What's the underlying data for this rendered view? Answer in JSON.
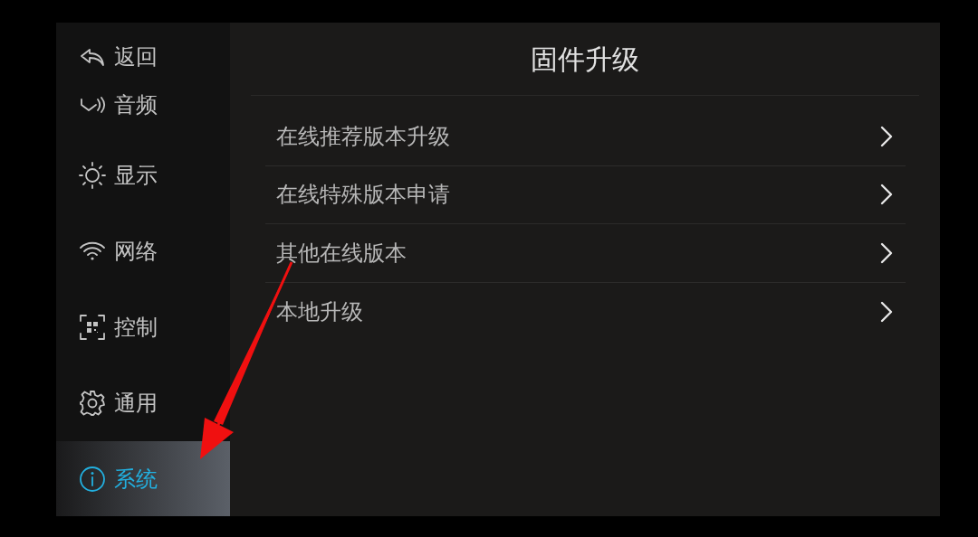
{
  "sidebar": {
    "back": {
      "label": "返回"
    },
    "items": [
      {
        "kind": "audio",
        "label": "音频",
        "selected": false
      },
      {
        "kind": "display",
        "label": "显示",
        "selected": false
      },
      {
        "kind": "network",
        "label": "网络",
        "selected": false
      },
      {
        "kind": "control",
        "label": "控制",
        "selected": false
      },
      {
        "kind": "general",
        "label": "通用",
        "selected": false
      },
      {
        "kind": "system",
        "label": "系统",
        "selected": true
      }
    ]
  },
  "page": {
    "title": "固件升级",
    "items": [
      {
        "label": "在线推荐版本升级"
      },
      {
        "label": "在线特殊版本申请"
      },
      {
        "label": "其他在线版本"
      },
      {
        "label": "本地升级"
      }
    ]
  }
}
